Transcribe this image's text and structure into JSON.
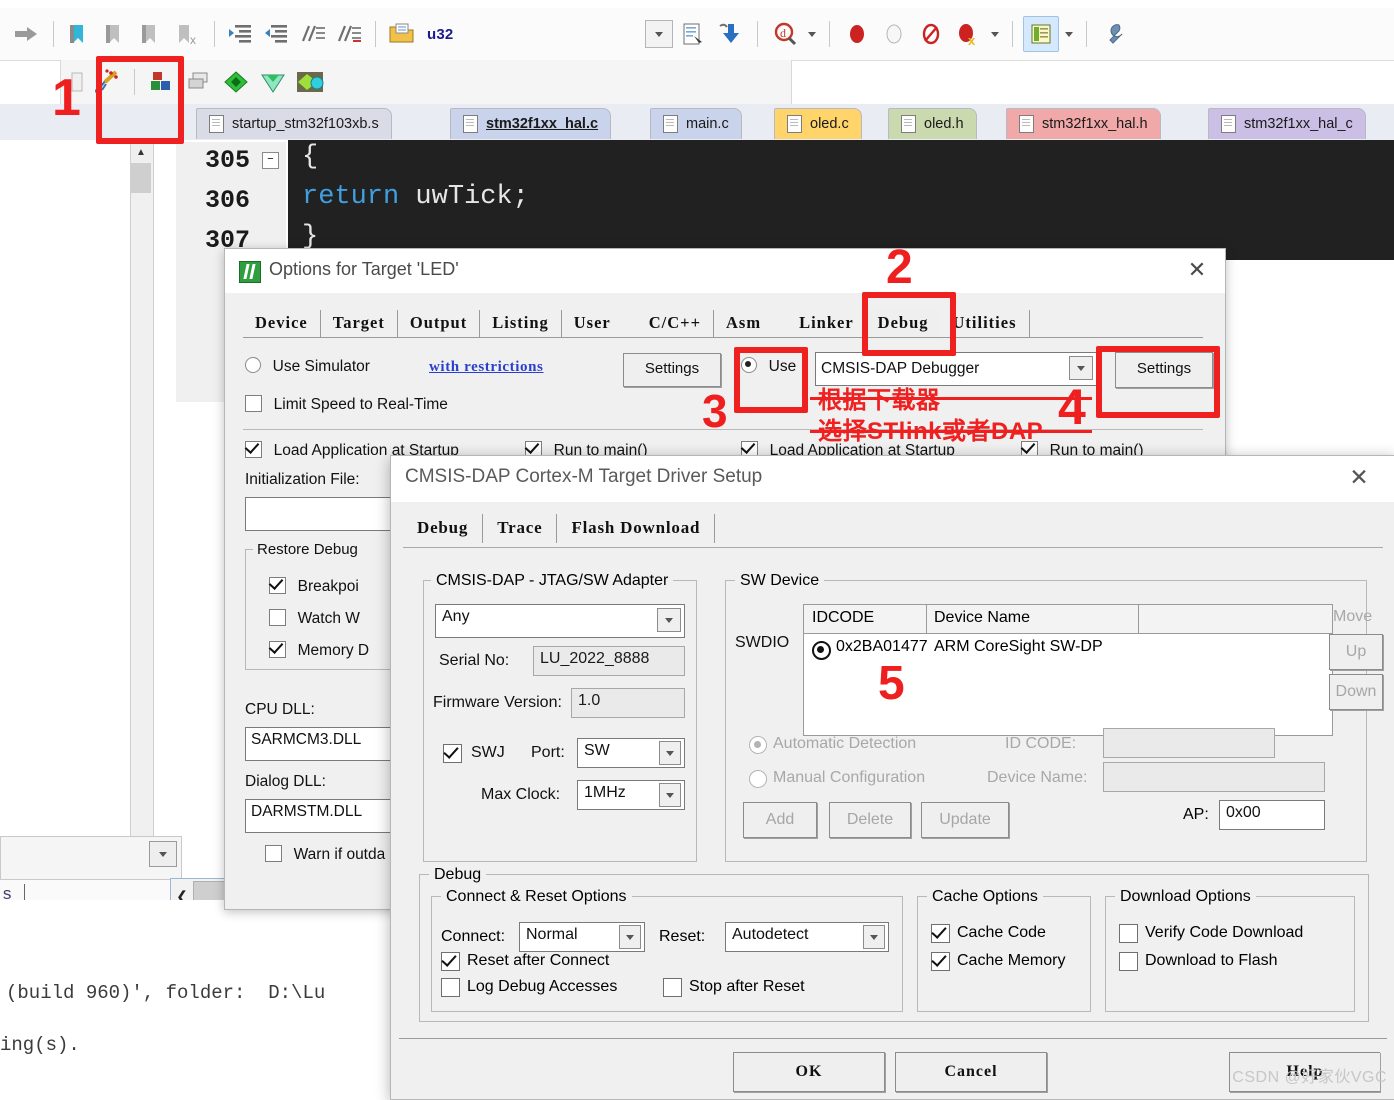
{
  "app": {
    "toolbar_project_label": "u32"
  },
  "toolbar_top": {
    "icons": [
      "arrow-right-icon",
      "bookmark-toggle-icon",
      "bookmark-prev-icon",
      "bookmark-next-icon",
      "bookmark-clear-icon",
      "indent-icon",
      "outdent-icon",
      "comment-icon",
      "uncomment-icon",
      "open-project-icon"
    ],
    "right_icons": [
      "dropdown-icon",
      "target-options-icon",
      "download-icon",
      "magnifier-icon",
      "breakpoint-icon",
      "breakpoint-disabled-icon",
      "breakpoint-toggle-icon",
      "kill-breakpoints-icon",
      "window-layout-icon",
      "configure-icon"
    ]
  },
  "toolbar_second": {
    "icons": [
      "pin-icon",
      "close-icon",
      "build-wizard-icon",
      "build-target-icon",
      "batch-build-icon",
      "manage-project-icon",
      "pack-installer-icon",
      "pack-manager-icon"
    ]
  },
  "editor_tabs": [
    {
      "label": "startup_stm32f103xb.s",
      "color": "#d9dbe6",
      "active": false
    },
    {
      "label": "stm32f1xx_hal.c",
      "color": "#c9d4ec",
      "active": true
    },
    {
      "label": "main.c",
      "color": "#c9d4ec",
      "active": false
    },
    {
      "label": "oled.c",
      "color": "#ffd46b",
      "active": false
    },
    {
      "label": "oled.h",
      "color": "#cbd9af",
      "active": false
    },
    {
      "label": "stm32f1xx_hal.h",
      "color": "#f0a8a8",
      "active": false
    },
    {
      "label": "stm32f1xx_hal_c",
      "color": "#cbbfe6",
      "active": false
    }
  ],
  "code": {
    "lines": [
      {
        "no": "305",
        "text": "{",
        "fold": true
      },
      {
        "no": "306",
        "text": "  return uwTick;",
        "fold": false
      },
      {
        "no": "307",
        "text": "}",
        "fold": false
      }
    ],
    "keyword": "return",
    "rest": " uwTick;"
  },
  "build_output": {
    "line1": "(build 960)', folder:  D:\\Lu",
    "line2": "ing(s)."
  },
  "options_dialog": {
    "title": "Options for Target 'LED'",
    "close_label": "✕",
    "tabs": [
      "Device",
      "Target",
      "Output",
      "Listing",
      "User",
      "C/C++",
      "Asm",
      "Linker",
      "Debug",
      "Utilities"
    ],
    "selected_tab": "Debug",
    "use_simulator_label": "Use Simulator",
    "with_restrictions_label": "with restrictions",
    "settings_left_label": "Settings",
    "limit_speed_label": "Limit Speed to Real-Time",
    "use_label": "Use",
    "debugger_value": "CMSIS-DAP Debugger",
    "settings_right_label": "Settings",
    "load_app_left_label": "Load Application at Startup",
    "run_to_main_left_label": "Run to main()",
    "load_app_right_label": "Load Application at Startup",
    "run_to_main_right_label": "Run to main()",
    "init_file_label": "Initialization File:",
    "init_file_value": "",
    "restore_debug_label": "Restore Debug",
    "restore_items": [
      "Breakpoi",
      "Watch W",
      "Memory D"
    ],
    "cpu_dll_label": "CPU DLL:",
    "cpu_dll_value": "SARMCM3.DLL",
    "dialog_dll_label": "Dialog DLL:",
    "dialog_dll_value": "DARMSTM.DLL",
    "warn_outdated_label": "Warn if outda"
  },
  "dap_dialog": {
    "title": "CMSIS-DAP Cortex-M Target Driver Setup",
    "close_label": "✕",
    "tabs": [
      "Debug",
      "Trace",
      "Flash Download"
    ],
    "selected_tab": "Debug",
    "adapter_group": "CMSIS-DAP - JTAG/SW Adapter",
    "adapter_value": "Any",
    "serial_label": "Serial No:",
    "serial_value": "LU_2022_8888",
    "firmware_label": "Firmware Version:",
    "firmware_value": "1.0",
    "swj_label": "SWJ",
    "port_label": "Port:",
    "port_value": "SW",
    "max_clock_label": "Max Clock:",
    "max_clock_value": "1MHz",
    "sw_device_group": "SW Device",
    "swdio_label": "SWDIO",
    "table_headers": [
      "IDCODE",
      "Device Name",
      ""
    ],
    "table_rows": [
      {
        "idcode": "0x2BA01477",
        "device_name": "ARM CoreSight SW-DP"
      }
    ],
    "move_label": "Move",
    "up_label": "Up",
    "down_label": "Down",
    "automatic_detection_label": "Automatic Detection",
    "manual_configuration_label": "Manual Configuration",
    "id_code_label": "ID CODE:",
    "id_code_value": "",
    "device_name_label": "Device Name:",
    "device_name_value": "",
    "add_label": "Add",
    "delete_label": "Delete",
    "update_label": "Update",
    "ap_label": "AP:",
    "ap_value": "0x00",
    "debug_group": "Debug",
    "connect_reset_group": "Connect & Reset Options",
    "connect_label": "Connect:",
    "connect_value": "Normal",
    "reset_label": "Reset:",
    "reset_value": "Autodetect",
    "reset_after_connect_label": "Reset after Connect",
    "log_debug_accesses_label": "Log Debug Accesses",
    "stop_after_reset_label": "Stop after Reset",
    "cache_group": "Cache Options",
    "cache_code_label": "Cache Code",
    "cache_memory_label": "Cache Memory",
    "download_group": "Download Options",
    "verify_code_label": "Verify Code Download",
    "download_flash_label": "Download to Flash",
    "ok_label": "OK",
    "cancel_label": "Cancel",
    "help_label": "Help"
  },
  "annotations": {
    "step1": "1",
    "step2": "2",
    "step3": "3",
    "step4": "4",
    "step5": "5",
    "note_line1": "根据下载器",
    "note_line2": "选择STlink或者DAP",
    "accent_color": "#ef2020"
  },
  "watermark": "CSDN @好家伙VGC"
}
